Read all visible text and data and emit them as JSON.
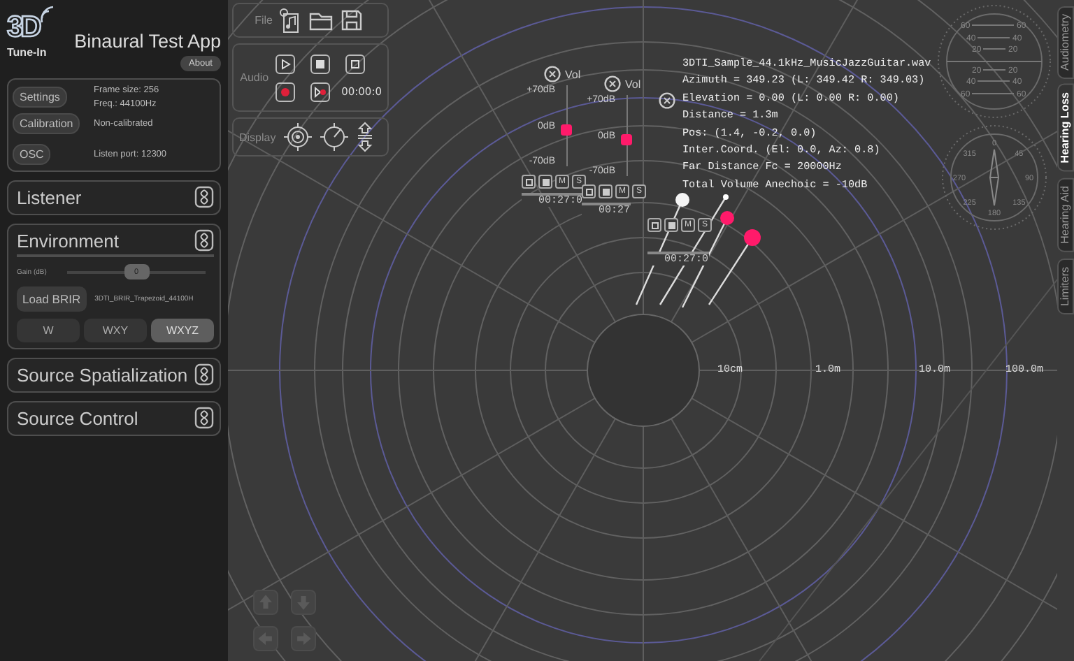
{
  "app": {
    "logo_mark": "3D",
    "logo_text": "Tune-In",
    "title": "Binaural Test App",
    "about_button": "About"
  },
  "settings_panel": {
    "buttons": [
      "Settings",
      "Calibration",
      "OSC"
    ],
    "frame_size": "Frame size: 256",
    "frequency": "Freq.: 44100Hz",
    "calibration_status": "Non-calibrated",
    "listen_port": "Listen port: 12300"
  },
  "sections": [
    {
      "title": "Listener",
      "expanded": false
    },
    {
      "title": "Environment",
      "expanded": true,
      "content": {
        "gain_label": "Gain (dB)",
        "gain": {
          "level": 0.5,
          "reading": "0"
        },
        "load_button": "Load BRIR",
        "brir_file": "3DTI_BRIR_Trapezoid_44100H",
        "modes": [
          {
            "label": "W",
            "selected": false
          },
          {
            "label": "WXY",
            "selected": false
          },
          {
            "label": "WXYZ",
            "selected": true
          }
        ]
      }
    },
    {
      "title": "Source Spatialization",
      "expanded": false
    },
    {
      "title": "Source Control",
      "expanded": false
    }
  ],
  "toolbar": {
    "file_label": "File",
    "audio_label": "Audio",
    "time": "00:00:0",
    "display_label": "Display"
  },
  "sources": [
    {
      "kind": "full",
      "vol_label": "Vol",
      "scale": [
        "+70dB",
        "0dB",
        "-70dB"
      ],
      "level": 0.45,
      "buttons": [
        "M",
        "S"
      ],
      "time": "00:27:0"
    },
    {
      "kind": "full",
      "vol_label": "Vol",
      "scale": [
        "+70dB",
        "0dB",
        "-70dB"
      ],
      "level": 0.45,
      "buttons": [
        "M",
        "S"
      ],
      "time": "00:27"
    },
    {
      "kind": "compact",
      "buttons": [
        "M",
        "S"
      ],
      "time": "00:27:0"
    }
  ],
  "source_info": [
    "3DTI_Sample_44.1kHz_MusicJazzGuitar.wav",
    "Azimuth = 349.23 (L: 349.42 R: 349.03)",
    "Elevation = 0.00 (L: 0.00 R: 0.00)",
    "Distance = 1.3m",
    "Pos: (1.4, -0.2, 0.0)",
    "Inter.Coord. (El: 0.0, Az: 0.8)",
    "Far Distance Fc = 20000Hz",
    "Total Volume Anechoic = -10dB"
  ],
  "distance_labels": [
    "10cm",
    "1.0m",
    "10.0m",
    "100.0m"
  ],
  "elevation_gauge": {
    "labels": [
      "60",
      "60",
      "40",
      "40",
      "20",
      "20",
      "20",
      "20",
      "40",
      "40",
      "60",
      "60"
    ]
  },
  "azimuth_compass": {
    "labels": [
      "0",
      "45",
      "90",
      "135",
      "180",
      "225",
      "270",
      "315"
    ]
  },
  "side_tabs": [
    {
      "label": "Audiometry",
      "selected": false
    },
    {
      "label": "Hearing Loss",
      "selected": true
    },
    {
      "label": "Hearing Aid",
      "selected": false
    },
    {
      "label": "Limiters",
      "selected": false
    }
  ]
}
